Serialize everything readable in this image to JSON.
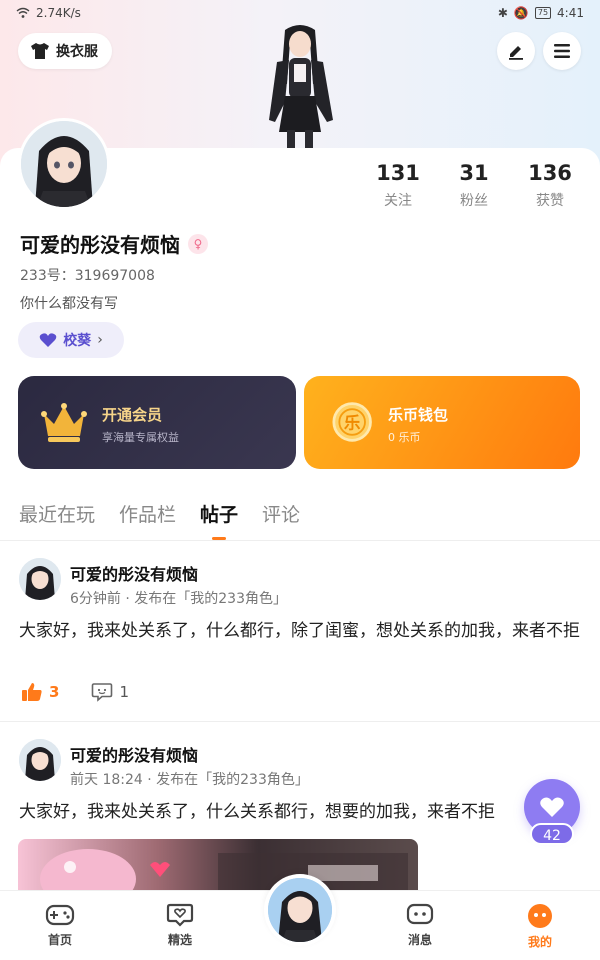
{
  "status_bar": {
    "network_speed": "2.74K/s",
    "battery": "75",
    "time": "4:41"
  },
  "header": {
    "skin_label": "换衣服"
  },
  "profile": {
    "stats": [
      {
        "value": "131",
        "label": "关注"
      },
      {
        "value": "31",
        "label": "粉丝"
      },
      {
        "value": "136",
        "label": "获赞"
      }
    ],
    "name": "可爱的彤没有烦恼",
    "uid": "233号：319697008",
    "bio": "你什么都没有写",
    "school": "校葵"
  },
  "cards": {
    "vip": {
      "title": "开通会员",
      "subtitle": "享海量专属权益"
    },
    "wallet": {
      "title": "乐币钱包",
      "subtitle": "0 乐币",
      "icon_char": "乐"
    }
  },
  "tabs": [
    {
      "label": "最近在玩",
      "active": false
    },
    {
      "label": "作品栏",
      "active": false
    },
    {
      "label": "帖子",
      "active": true
    },
    {
      "label": "评论",
      "active": false
    }
  ],
  "posts": [
    {
      "author": "可爱的彤没有烦恼",
      "meta": "6分钟前 · 发布在「我的233角色」",
      "text": "大家好，我来处关系了，什么都行，除了闺蜜，想处关系的加我，来者不拒",
      "likes": "3",
      "comments": "1"
    },
    {
      "author": "可爱的彤没有烦恼",
      "meta": "前天 18:24 · 发布在「我的233角色」",
      "text": "大家好，我来处关系了，什么关系都行，想要的加我，来者不拒"
    }
  ],
  "float_like": {
    "count": "42"
  },
  "bottom_nav": [
    {
      "label": "首页",
      "icon": "gamepad-icon",
      "active": false
    },
    {
      "label": "精选",
      "icon": "heart-chat-icon",
      "active": false
    },
    {
      "label": "",
      "icon": "avatar",
      "active": false
    },
    {
      "label": "消息",
      "icon": "message-icon",
      "active": false
    },
    {
      "label": "我的",
      "icon": "face-icon",
      "active": true
    }
  ],
  "colors": {
    "accent": "#ff7a1a",
    "vip_bg": "#2b2940",
    "wallet_bg": "#ff9414",
    "float_like": "#8e7cf2",
    "school_chip": "#5a4fcf"
  }
}
